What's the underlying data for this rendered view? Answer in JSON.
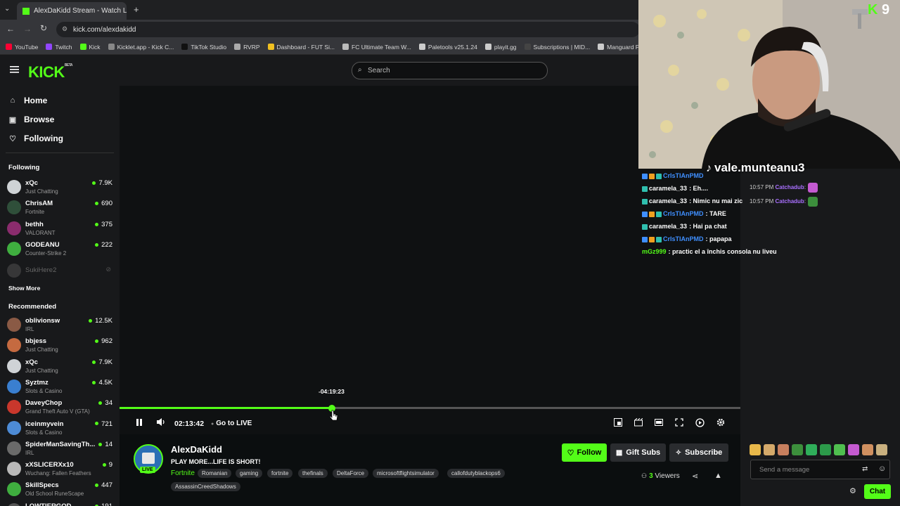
{
  "browser": {
    "tab_title": "AlexDaKidd Stream - Watch Liv",
    "url": "kick.com/alexdakidd",
    "bookmarks": [
      {
        "label": "YouTube",
        "color": "#ff0033"
      },
      {
        "label": "Twitch",
        "color": "#9146ff"
      },
      {
        "label": "Kick",
        "color": "#53fc18"
      },
      {
        "label": "Kicklet.app - Kick C...",
        "color": "#888888"
      },
      {
        "label": "TikTok Studio",
        "color": "#111111"
      },
      {
        "label": "RVRP",
        "color": "#aaaaaa"
      },
      {
        "label": "Dashboard - FUT Si...",
        "color": "#f0c020"
      },
      {
        "label": "FC Ultimate Team W...",
        "color": "#bbbbbb"
      },
      {
        "label": "Paletools v25.1.24",
        "color": "#cccccc"
      },
      {
        "label": "playit.gg",
        "color": "#cccccc"
      },
      {
        "label": "Subscriptions | MID...",
        "color": "#444444"
      },
      {
        "label": "Manguard Plus",
        "color": "#cccccc"
      }
    ]
  },
  "header": {
    "logo": "KICK",
    "logo_sup": "BETA",
    "search_placeholder": "Search"
  },
  "nav": {
    "home": "Home",
    "browse": "Browse",
    "following": "Following"
  },
  "sidebar": {
    "following_title": "Following",
    "following": [
      {
        "name": "xQc",
        "category": "Just Chatting",
        "viewers": "7.9K",
        "color": "#cfd3d6"
      },
      {
        "name": "ChrisAM",
        "category": "Fortnite",
        "viewers": "690",
        "color": "#2f4f3a"
      },
      {
        "name": "bethh",
        "category": "VALORANT",
        "viewers": "375",
        "color": "#8a2c6d"
      },
      {
        "name": "GODEANU",
        "category": "Counter-Strike 2",
        "viewers": "222",
        "color": "#3fae3f"
      }
    ],
    "offline_name": "SukiHere2",
    "show_more": "Show More",
    "recommended_title": "Recommended",
    "recommended": [
      {
        "name": "oblivionsw",
        "category": "IRL",
        "viewers": "12.5K",
        "color": "#8a5a45"
      },
      {
        "name": "bbjess",
        "category": "Just Chatting",
        "viewers": "962",
        "color": "#c56a40"
      },
      {
        "name": "xQc",
        "category": "Just Chatting",
        "viewers": "7.9K",
        "color": "#cfd3d6"
      },
      {
        "name": "Syztmz",
        "category": "Slots & Casino",
        "viewers": "4.5K",
        "color": "#3a7fd0"
      },
      {
        "name": "DaveyChop",
        "category": "Grand Theft Auto V (GTA)",
        "viewers": "34",
        "color": "#c9372c"
      },
      {
        "name": "iceinmyvein",
        "category": "Slots & Casino",
        "viewers": "721",
        "color": "#4d8bd6"
      },
      {
        "name": "SpiderManSavingTh...",
        "category": "IRL",
        "viewers": "14",
        "color": "#6a6a6a"
      },
      {
        "name": "xXSLICERXx10",
        "category": "Wuchang: Fallen Feathers",
        "viewers": "9",
        "color": "#b9b9b9"
      },
      {
        "name": "SkillSpecs",
        "category": "Old School RuneScape",
        "viewers": "447",
        "color": "#3fae3f"
      },
      {
        "name": "LOWTIERGOD",
        "category": "",
        "viewers": "191",
        "color": "#555555"
      }
    ]
  },
  "player": {
    "tooltip": "-04:19:23",
    "elapsed": "02:13:42",
    "go_live": "Go to LIVE",
    "progress": 0.342
  },
  "stream": {
    "name": "AlexDaKidd",
    "live": "LIVE",
    "title": "PLAY MORE...LIFE IS SHORT!",
    "category": "Fortnite",
    "tags": [
      "Romanian",
      "gaming",
      "fortnite",
      "thefinals",
      "DeltaForce",
      "microsoftflightsimulator",
      "callofdutyblackops6",
      "AssassinCreedShadows"
    ],
    "follow": "Follow",
    "gift_subs": "Gift Subs",
    "subscribe": "Subscribe",
    "viewers_count": "3",
    "viewers_label": "Viewers"
  },
  "overlay": {
    "tiktok_handle": "vale.munteanu3",
    "kick_count": "9",
    "chat": [
      {
        "user": "CrIsTIAnPMD",
        "text": "",
        "color": "#3f8fff"
      },
      {
        "user": "caramela_33",
        "text": ": Eh....",
        "color": "#ffffff"
      },
      {
        "user": "caramela_33",
        "text": ": Nimic nu mai zic",
        "color": "#ffffff"
      },
      {
        "user": "CrIsTIAnPMD",
        "text": ": TARE",
        "color": "#3f8fff"
      },
      {
        "user": "caramela_33",
        "text": ": Hai pa chat",
        "color": "#ffffff"
      },
      {
        "user": "CrIsTIAnPMD",
        "text": ": papapa",
        "color": "#3f8fff"
      },
      {
        "user": "mGz999",
        "text": ": practic el a închis consola nu liveu",
        "color": "#53fc18"
      }
    ],
    "right_chat": [
      {
        "time": "10:57 PM",
        "user": "Catchadub",
        ":": ":"
      },
      {
        "time": "10:57 PM",
        "user": "Catchadub",
        ":": ":"
      }
    ]
  },
  "chat_panel": {
    "placeholder": "Send a message",
    "chat_button": "Chat"
  }
}
